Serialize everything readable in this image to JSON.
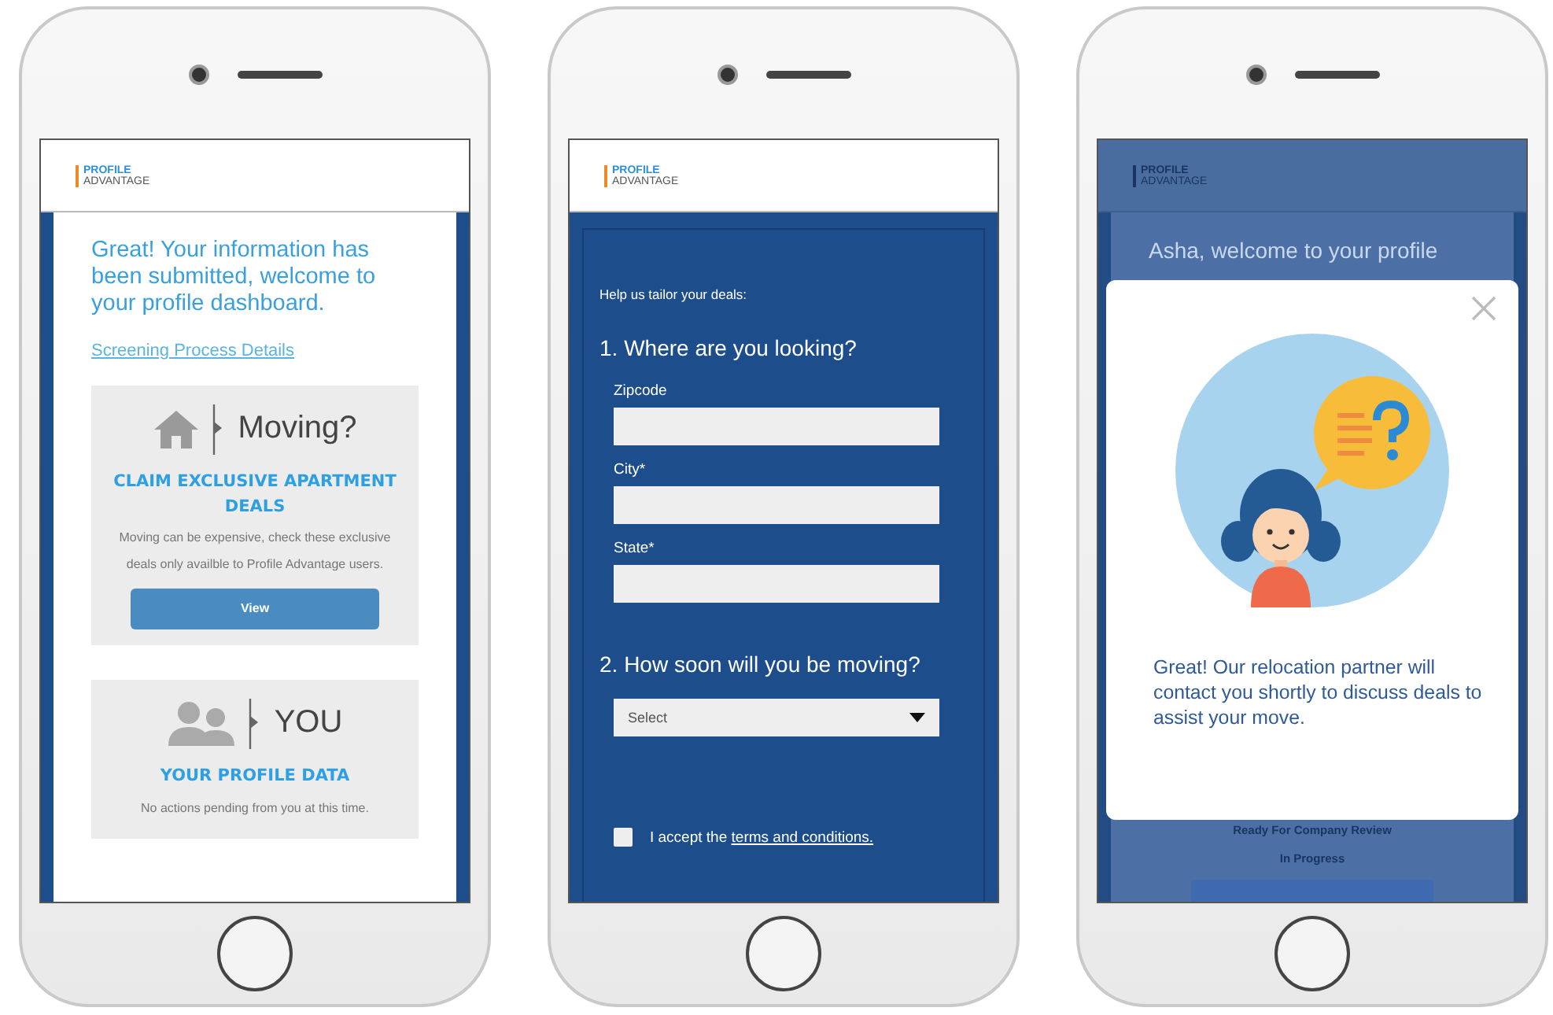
{
  "dashboard_screen": {
    "logo": {
      "line1": "PROFILE",
      "line2": "ADVANTAGE"
    },
    "heading": "Great! Your information has been submitted, welcome to your profile dashboard.",
    "link": "Screening Process Details",
    "cards": [
      {
        "kind": "moving",
        "title": "Moving?",
        "subtitle": "CLAIM EXCLUSIVE APARTMENT DEALS",
        "text": "Moving can be expensive, check these exclusive deals only availble to Profile Advantage users.",
        "button": "View"
      },
      {
        "kind": "profile",
        "title": "YOU",
        "subtitle": "YOUR PROFILE DATA",
        "text": "No actions pending from you at this time."
      }
    ]
  },
  "form_screen": {
    "logo": {
      "line1": "PROFILE",
      "line2": "ADVANTAGE"
    },
    "intro": "Help us tailor your deals:",
    "sections": [
      {
        "title": "1. Where are you looking?",
        "fields": [
          {
            "kind": "text",
            "label": "Zipcode"
          },
          {
            "kind": "text",
            "label": "City*"
          },
          {
            "kind": "text",
            "label": "State*"
          }
        ]
      },
      {
        "title": "2. How soon will you be moving?",
        "fields": [
          {
            "kind": "select",
            "value": "Select"
          }
        ]
      }
    ],
    "terms": {
      "checked": false,
      "text": "I accept the ",
      "link": "terms and conditions."
    }
  },
  "confirmation_screen": {
    "logo": {
      "line1": "PROFILE",
      "line2": "ADVANTAGE"
    },
    "heading": "Asha, welcome to your profile",
    "modal": {
      "message": "Great! Our relocation partner will contact you shortly to discuss deals to assist your move."
    },
    "status_lines": [
      "Ready For Company Review",
      "In Progress"
    ]
  }
}
